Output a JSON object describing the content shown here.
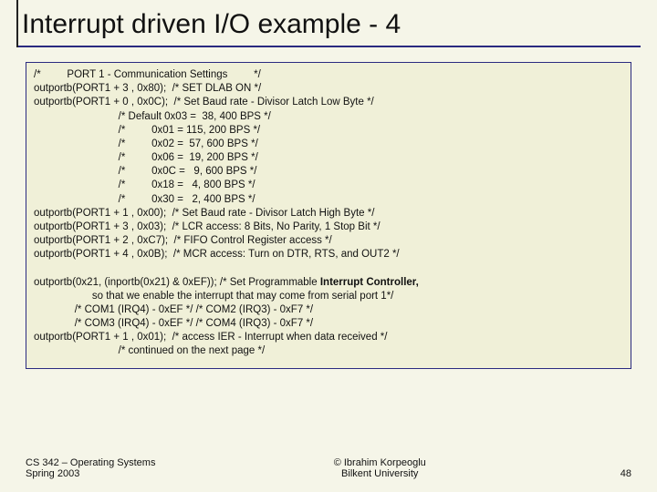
{
  "title": "Interrupt driven I/O example - 4",
  "codeblock1": "/*         PORT 1 - Communication Settings         */\noutportb(PORT1 + 3 , 0x80);  /* SET DLAB ON */\noutportb(PORT1 + 0 , 0x0C);  /* Set Baud rate - Divisor Latch Low Byte */\n                             /* Default 0x03 =  38, 400 BPS */\n                             /*         0x01 = 115, 200 BPS */\n                             /*         0x02 =  57, 600 BPS */\n                             /*         0x06 =  19, 200 BPS */\n                             /*         0x0C =   9, 600 BPS */\n                             /*         0x18 =   4, 800 BPS */\n                             /*         0x30 =   2, 400 BPS */\noutportb(PORT1 + 1 , 0x00);  /* Set Baud rate - Divisor Latch High Byte */\noutportb(PORT1 + 3 , 0x03);  /* LCR access: 8 Bits, No Parity, 1 Stop Bit */\noutportb(PORT1 + 2 , 0xC7);  /* FIFO Control Register access */\noutportb(PORT1 + 4 , 0x0B);  /* MCR access: Turn on DTR, RTS, and OUT2 */",
  "codeblock2_prefix": "outportb(0x21, (inportb(0x21) & 0xEF)); /* Set Programmable ",
  "codeblock2_bold": "Interrupt Controller,",
  "codeblock2_rest": "                    so that we enable the interrupt that may come from serial port 1*/\n              /* COM1 (IRQ4) - 0xEF */ /* COM2 (IRQ3) - 0xF7 */\n              /* COM3 (IRQ4) - 0xEF */ /* COM4 (IRQ3) - 0xF7 */\noutportb(PORT1 + 1 , 0x01);  /* access IER - Interrupt when data received */\n                             /* continued on the next page */",
  "footer": {
    "left_line1": "CS 342 – Operating Systems",
    "left_line2": "Spring 2003",
    "center_line1": "© Ibrahim Korpeoglu",
    "center_line2": "Bilkent University",
    "pagenum": "48"
  }
}
